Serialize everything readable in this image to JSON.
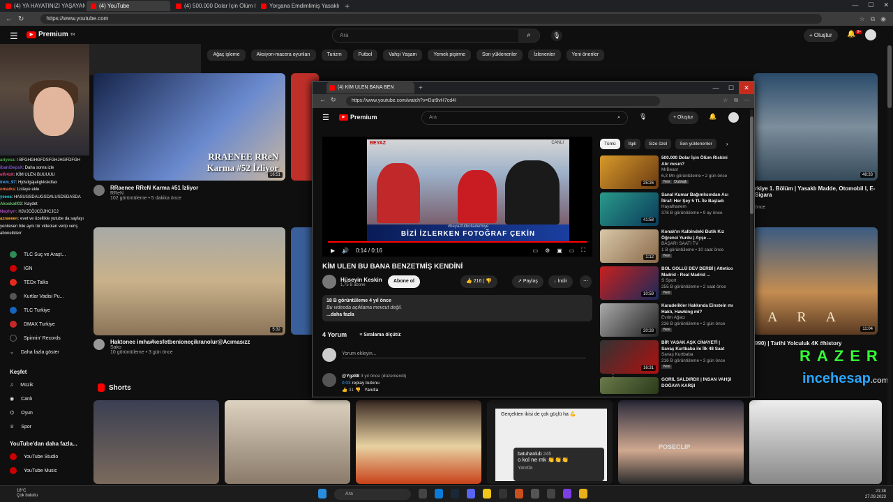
{
  "browser": {
    "tabs": [
      "(4) YA HAYATINIZI YAŞAYAN BAŞIN",
      "(4) YouTube",
      "(4) 500.000 Dolar İçin Ölüm Riskini",
      "Yorgana Emdimlimiş Yasaklı Madde"
    ],
    "url": "https://www.youtube.com"
  },
  "yt": {
    "logo": "Premium",
    "logo_sup": "TR",
    "search_placeholder": "Ara",
    "create_label": "Oluştur",
    "notif_count": "9+",
    "chips": [
      "ılı",
      "Ağaç işleme",
      "Aksiyon-macera oyunları",
      "Turizm",
      "Futbol",
      "Vahşi Yaşam",
      "Yemek pişirme",
      "Son yüklenenler",
      "İzlenenler",
      "Yeni öneriler"
    ]
  },
  "sidebar": {
    "subs": [
      {
        "label": "TLC Suç ve Araşt...",
        "color": "#2e8b57"
      },
      {
        "label": "IGN",
        "color": "#cc0000"
      },
      {
        "label": "TEDx Talks",
        "color": "#e62b1e"
      },
      {
        "label": "Kurtlar Vadisi Pu...",
        "color": "#555555"
      },
      {
        "label": "TLC Turkiye",
        "color": "#1565c0"
      },
      {
        "label": "DMAX Turkiye",
        "color": "#c62828"
      },
      {
        "label": "Spinnin' Records",
        "color": "#111111"
      }
    ],
    "more": "Daha fazla göster",
    "explore_title": "Keşfet",
    "explore": [
      "Müzik",
      "Canlı",
      "Oyun",
      "Spor"
    ],
    "more_from": "YouTube'dan daha fazla...",
    "more_items": [
      "YouTube Studio",
      "YouTube Music"
    ]
  },
  "chat": [
    {
      "user": "ariyesa",
      "text": "I BFGHGHGFDSFGHJHGFDFGH"
    },
    {
      "user": "ibaniSepsX",
      "text": "Daha sonra izle"
    },
    {
      "user": "elfr4xlt",
      "text": "KİM ULEN BUUUUU"
    },
    {
      "user": "irem_97",
      "text": "Hjdsdgajakgkkskdlax"
    },
    {
      "user": "omarks",
      "text": "Listeye ekle"
    },
    {
      "user": "yeeea",
      "text": "HASUGSDAUGSDALUSDSDASDA"
    },
    {
      "user": "Akoskatl02",
      "text": "Kaydet"
    },
    {
      "user": "Nephyrr",
      "text": "HJVJCÖJCÖJHCJCJ"
    },
    {
      "user": "azraeeen",
      "text": "evet ve özellikle yutube da sayfayı yenilesen bile aynı tür videoları verip veriş"
    },
    {
      "user": "",
      "text": "aboneliklerr"
    }
  ],
  "videos": [
    {
      "title": "RRaenee RReN Karma #51 İzliyor",
      "channel": "RReN",
      "meta": "102 görüntüleme • 5 dakika önce",
      "duration": "16:51",
      "overlay": "RRAENEE RReN Karma #52 İzliyor"
    },
    {
      "title": "Haktonee imha#kesfetbenioneçikranolur@Acımasızz",
      "channel": "Sako",
      "meta": "10 görüntüleme • 3 gün önce",
      "duration": "5:32"
    },
    {
      "title": "rkiye 1. Bölüm | Yasaklı Madde, Otomobil I, E-Sigara",
      "meta": "önce",
      "duration": "48:33"
    },
    {
      "title": "990) | Tarihi Yolculuk 4K #history",
      "duration": "11:04",
      "overlay": "A R A"
    }
  ],
  "shorts_label": "Shorts",
  "short_comment": {
    "header": "Gerçekten ikisi de çok güçlü ha 💪",
    "user": "batuhanlub",
    "time": "24h",
    "text": "o kol ne mk 👏👏👏",
    "reply": "Yanıtla"
  },
  "short_watermark": "POSECLIP",
  "brand": {
    "razer": "RAZER",
    "ince": "incehesap",
    "ince_tld": ".com"
  },
  "popup": {
    "tab": "(4) KİM ULEN BANA BEN",
    "url": "https://www.youtube.com/watch?v=Dut9vH7cd4I",
    "search_placeholder": "Ara",
    "create_label": "Oluştur",
    "video_title": "KİM ULEN BU BANA BENZETMİŞ KENDİNİ",
    "channel": "Hüseyin Keskin",
    "subs": "1,75 B abone",
    "subscribe": "Abone ol",
    "likes": "216",
    "share": "Paylaş",
    "download": "İndir",
    "time": "0:14 / 0:16",
    "tv_top": "#beyazfutbolladerbiye",
    "tv_big": "BİZİ İZLERKEN FOTOĞRAF ÇEKİN",
    "tv_small": "CANLI YAYINDA EKRANA GELİN",
    "tv_logo": "BEYAZ",
    "tv_live": "CANLI",
    "views": "18 B görüntüleme  4 yıl önce",
    "desc": "Bu videoda açıklama mevcut değil.",
    "more": "...daha fazla",
    "comments_count": "4 Yorum",
    "sort": "Sıralama ölçütü:",
    "add_comment": "Yorum ekleyin...",
    "comment": {
      "user": "@Ygz88",
      "meta": "3 yıl önce (düzenlendi)",
      "time": "0:03",
      "text": "replay butonu",
      "likes": "31",
      "reply": "Yanıtla"
    },
    "rchips": [
      "Tümü",
      "İlgili",
      "Size özel",
      "Son yüklenenler"
    ],
    "recs": [
      {
        "title": "500.000 Dolar İçin Ölüm Riskini Alır mısın?",
        "channel": "MrBeast",
        "meta": "6,3 Mn görüntüleme • 2 gün önce",
        "badge": "Yeni",
        "badge2": "Dublajlı",
        "dur": "25:26",
        "c1": "#d89a2a",
        "c2": "#6a3a12"
      },
      {
        "title": "Sanal Kumar Bağımlısından Acı İtiraf: Her Şey 5 TL İle Başladı",
        "channel": "Hayalhanem",
        "meta": "378 B görüntüleme • 9 ay önce",
        "dur": "41:58",
        "c1": "#2a9a8a",
        "c2": "#0a3a5a"
      },
      {
        "title": "Konak'ın Kalbindeki Butik Kız Öğrenci Yurdu | Ayşe ...",
        "channel": "BAŞARI SAATİ TV",
        "meta": "1 B görüntüleme • 10 saat önce",
        "badge": "Yeni",
        "dur": "1:12",
        "c1": "#d8c8a8",
        "c2": "#8a6a4a"
      },
      {
        "title": "BOL GOLLÜ DEV DERBİ | Atletico Madrid - Real Madrid ...",
        "channel": "S Sport",
        "meta": "255 B görüntüleme • 2 saat önce",
        "badge": "Yeni",
        "dur": "10:59",
        "c1": "#c8201e",
        "c2": "#1a2a5a"
      },
      {
        "title": "Karadelikler Hakkında Einstein mı Haklı, Hawking mi?",
        "channel": "Evrim Ağacı",
        "meta": "236 B görüntüleme • 2 gün önce",
        "badge": "Yeni",
        "dur": "20:28",
        "c1": "#aaaaaa",
        "c2": "#222222"
      },
      {
        "title": "BİR YASAK AŞK CİNAYETİ | Savaş Kurtbaba ile İlk 48 Saat",
        "channel": "Savaş Kurtbaba",
        "meta": "216 B görüntüleme • 3 gün önce",
        "badge": "Yeni",
        "dur": "16:31",
        "c1": "#333333",
        "c2": "#b01010"
      },
      {
        "title": "GORİL SALDIRDI! | İNSAN VAHŞİ DOĞAYA KARŞI",
        "channel": "",
        "meta": "",
        "dur": "",
        "c1": "#6a7a4a",
        "c2": "#2a3a1a"
      }
    ]
  },
  "taskbar": {
    "temp": "18°C",
    "weather": "Çok bulutlu",
    "search": "Ara",
    "time": "21:38",
    "date": "27.09.2023"
  }
}
